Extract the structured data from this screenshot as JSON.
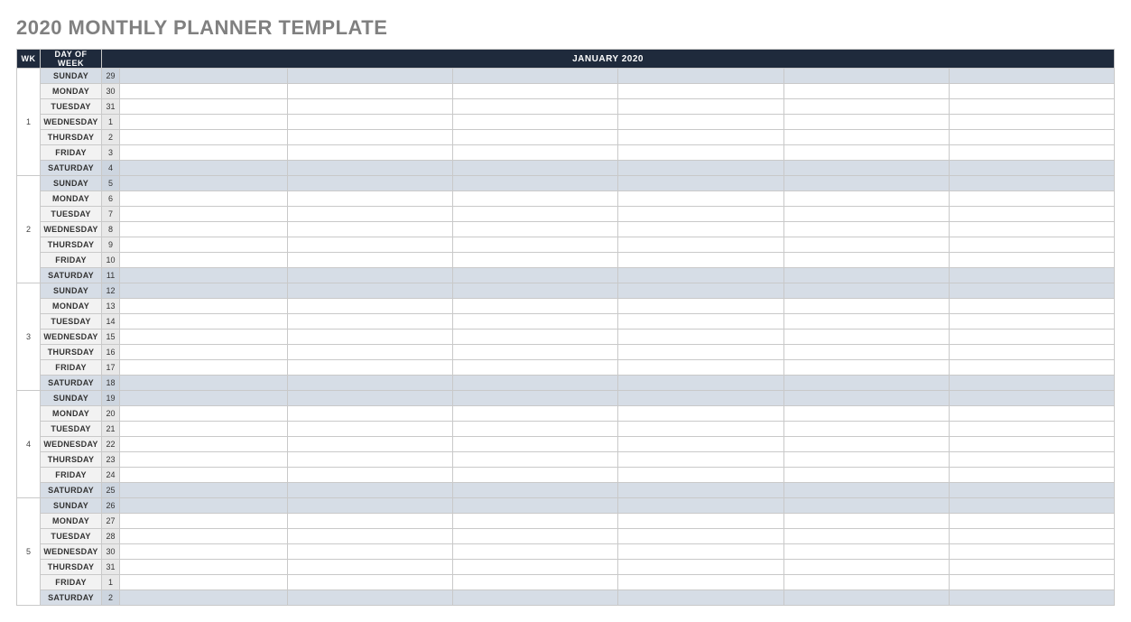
{
  "title": "2020 MONTHLY PLANNER TEMPLATE",
  "headers": {
    "wk": "WK",
    "dow": "DAY OF WEEK",
    "month": "JANUARY 2020"
  },
  "weeks": [
    {
      "wk": "1",
      "days": [
        {
          "dow": "SUNDAY",
          "date": "29",
          "weekend": true
        },
        {
          "dow": "MONDAY",
          "date": "30",
          "weekend": false
        },
        {
          "dow": "TUESDAY",
          "date": "31",
          "weekend": false
        },
        {
          "dow": "WEDNESDAY",
          "date": "1",
          "weekend": false
        },
        {
          "dow": "THURSDAY",
          "date": "2",
          "weekend": false
        },
        {
          "dow": "FRIDAY",
          "date": "3",
          "weekend": false
        },
        {
          "dow": "SATURDAY",
          "date": "4",
          "weekend": true
        }
      ]
    },
    {
      "wk": "2",
      "days": [
        {
          "dow": "SUNDAY",
          "date": "5",
          "weekend": true
        },
        {
          "dow": "MONDAY",
          "date": "6",
          "weekend": false
        },
        {
          "dow": "TUESDAY",
          "date": "7",
          "weekend": false
        },
        {
          "dow": "WEDNESDAY",
          "date": "8",
          "weekend": false
        },
        {
          "dow": "THURSDAY",
          "date": "9",
          "weekend": false
        },
        {
          "dow": "FRIDAY",
          "date": "10",
          "weekend": false
        },
        {
          "dow": "SATURDAY",
          "date": "11",
          "weekend": true
        }
      ]
    },
    {
      "wk": "3",
      "days": [
        {
          "dow": "SUNDAY",
          "date": "12",
          "weekend": true
        },
        {
          "dow": "MONDAY",
          "date": "13",
          "weekend": false
        },
        {
          "dow": "TUESDAY",
          "date": "14",
          "weekend": false
        },
        {
          "dow": "WEDNESDAY",
          "date": "15",
          "weekend": false
        },
        {
          "dow": "THURSDAY",
          "date": "16",
          "weekend": false
        },
        {
          "dow": "FRIDAY",
          "date": "17",
          "weekend": false
        },
        {
          "dow": "SATURDAY",
          "date": "18",
          "weekend": true
        }
      ]
    },
    {
      "wk": "4",
      "days": [
        {
          "dow": "SUNDAY",
          "date": "19",
          "weekend": true
        },
        {
          "dow": "MONDAY",
          "date": "20",
          "weekend": false
        },
        {
          "dow": "TUESDAY",
          "date": "21",
          "weekend": false
        },
        {
          "dow": "WEDNESDAY",
          "date": "22",
          "weekend": false
        },
        {
          "dow": "THURSDAY",
          "date": "23",
          "weekend": false
        },
        {
          "dow": "FRIDAY",
          "date": "24",
          "weekend": false
        },
        {
          "dow": "SATURDAY",
          "date": "25",
          "weekend": true
        }
      ]
    },
    {
      "wk": "5",
      "days": [
        {
          "dow": "SUNDAY",
          "date": "26",
          "weekend": true
        },
        {
          "dow": "MONDAY",
          "date": "27",
          "weekend": false
        },
        {
          "dow": "TUESDAY",
          "date": "28",
          "weekend": false
        },
        {
          "dow": "WEDNESDAY",
          "date": "30",
          "weekend": false
        },
        {
          "dow": "THURSDAY",
          "date": "31",
          "weekend": false
        },
        {
          "dow": "FRIDAY",
          "date": "1",
          "weekend": false
        },
        {
          "dow": "SATURDAY",
          "date": "2",
          "weekend": true
        }
      ]
    }
  ]
}
